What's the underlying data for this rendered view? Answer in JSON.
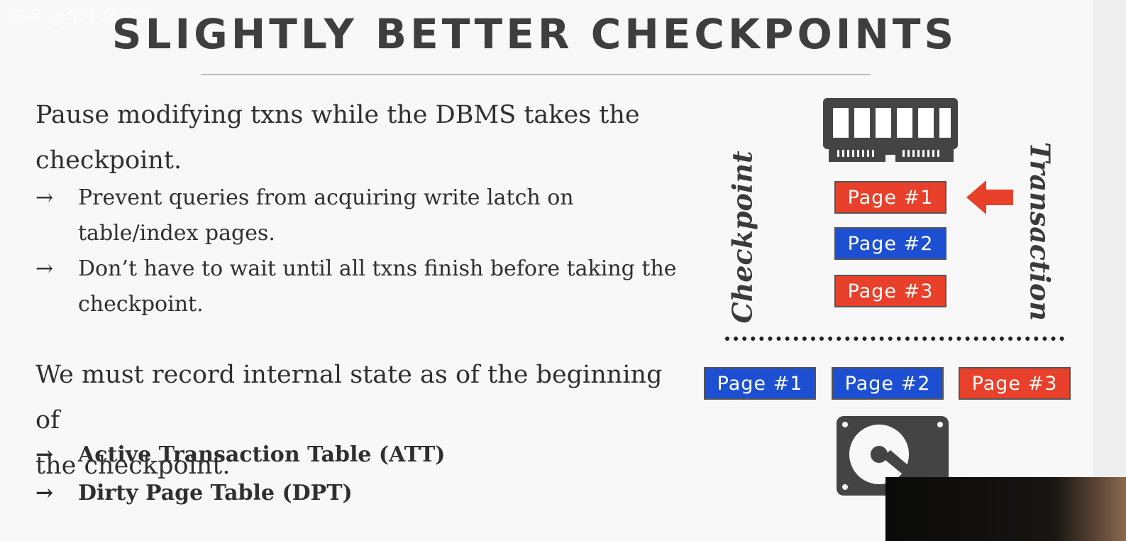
{
  "overlay_text": "知乎 @学生数据库",
  "slide": {
    "title": "SLIGHTLY BETTER CHECKPOINTS",
    "para1_line1": "Pause modifying txns while the DBMS takes the",
    "para1_line2": "checkpoint.",
    "bullets1": [
      {
        "arrow": "→",
        "line1": "Prevent queries from acquiring write latch on",
        "line2": "table/index pages."
      },
      {
        "arrow": "→",
        "line1": "Don’t have to wait until all txns finish before taking the",
        "line2": "checkpoint."
      }
    ],
    "para2_line1": "We must record internal state as of the beginning of",
    "para2_line2": "the checkpoint.",
    "bullets2": [
      {
        "arrow": "→",
        "text": "Active Transaction Table (ATT)"
      },
      {
        "arrow": "→",
        "text": "Dirty Page Table (DPT)"
      }
    ]
  },
  "diagram": {
    "checkpoint_label": "Checkpoint",
    "transaction_label": "Transaction",
    "memory_pages": [
      {
        "label": "Page  #1",
        "color": "#e8402a"
      },
      {
        "label": "Page  #2",
        "color": "#1c4fd1"
      },
      {
        "label": "Page  #3",
        "color": "#e8402a"
      }
    ],
    "disk_pages": [
      {
        "label": "Page  #1",
        "color": "#1c4fd1"
      },
      {
        "label": "Page  #2",
        "color": "#1c4fd1"
      },
      {
        "label": "Page  #3",
        "color": "#e8402a"
      }
    ],
    "arrow_color": "#e8402a",
    "memory_icon": "ram-icon",
    "disk_icon": "hard-disk-icon"
  }
}
